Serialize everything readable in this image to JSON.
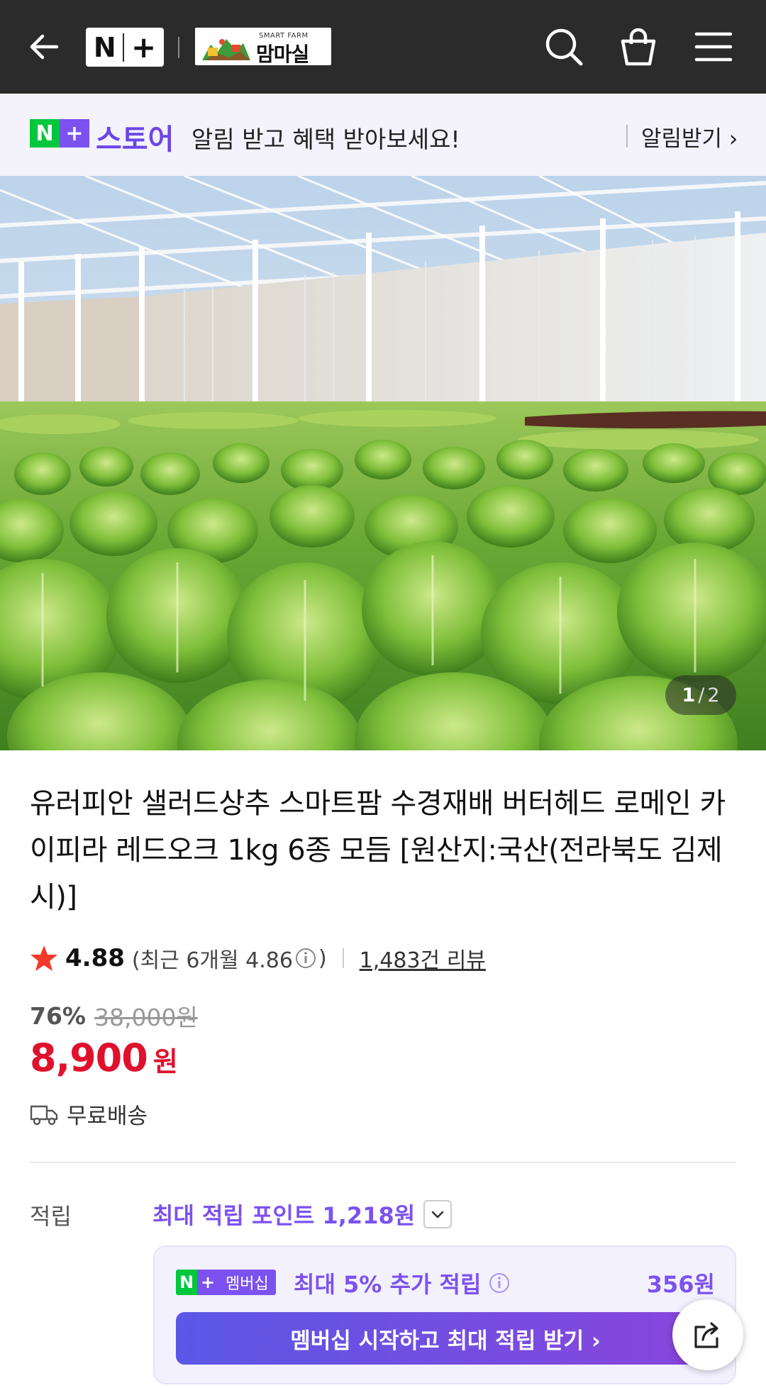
{
  "header": {
    "back_icon": "arrow-left-icon",
    "np_logo": "N+",
    "farm_logo_small": "SMART FARM",
    "farm_logo_name": "맘마실",
    "icons": [
      "search-icon",
      "shopping-bag-icon",
      "menu-icon"
    ]
  },
  "notice": {
    "brand": "스토어",
    "message": "알림 받고 혜택 받아보세요!",
    "cta": "알림받기 ›"
  },
  "hero": {
    "current": "1",
    "separator": "/",
    "total": "2"
  },
  "product": {
    "title": "유러피안 샐러드상추 스마트팜 수경재배 버터헤드 로메인 카이피라 레드오크 1kg 6종 모듬 [원산지:국산(전라북도 김제시)]",
    "rating": "4.88",
    "recent_prefix": "(최근 6개월 4.86",
    "recent_suffix": ")",
    "reviews": "1,483건 리뷰",
    "discount_pct": "76%",
    "original_price": "38,000원",
    "price": "8,900",
    "currency": "원",
    "shipping": "무료배송"
  },
  "points": {
    "label": "적립",
    "max_points": "최대 적립 포인트 1,218원",
    "membership_badge": "멤버십",
    "membership_text": "최대 5% 추가 적립",
    "membership_amount": "356원",
    "membership_cta": "멤버십 시작하고 최대 적립 받기 ›"
  },
  "colors": {
    "accent_purple": "#7b52f0",
    "naver_green": "#00c73c",
    "price_red": "#e0112c",
    "header_bg": "#2b2b2b"
  }
}
